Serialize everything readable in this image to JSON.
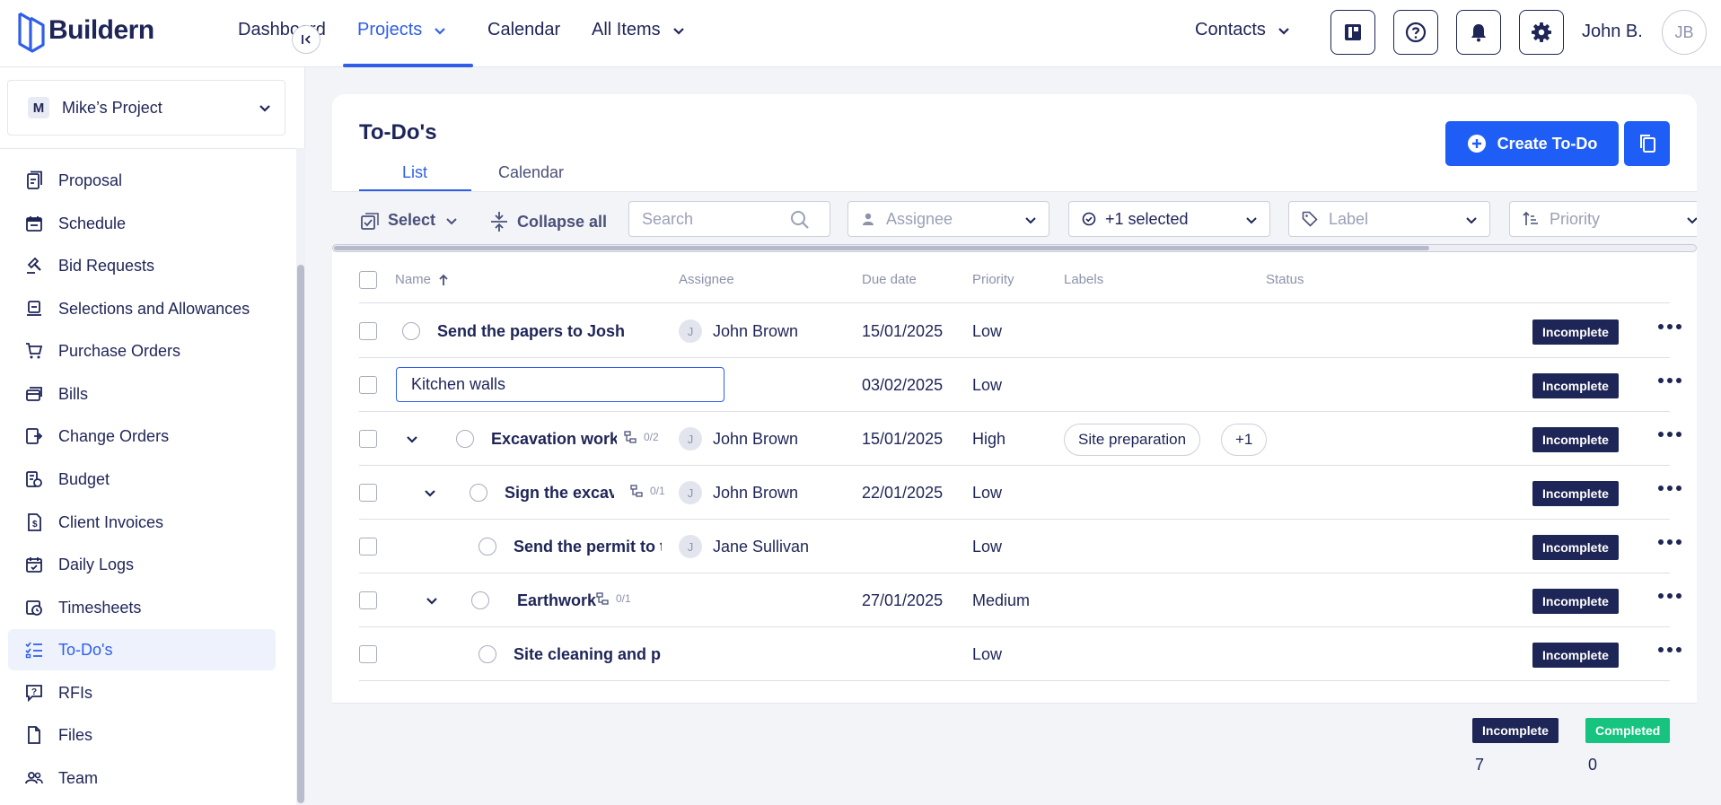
{
  "app": {
    "name": "Buildern"
  },
  "nav": {
    "dashboard": "Dashboard",
    "projects": "Projects",
    "calendar": "Calendar",
    "all_items": "All Items",
    "contacts": "Contacts"
  },
  "user": {
    "name": "John B.",
    "initials": "JB"
  },
  "sidebar": {
    "project_initial": "M",
    "project_name": "Mike’s Project",
    "items": [
      {
        "label": "Proposal",
        "icon": "proposal-icon"
      },
      {
        "label": "Schedule",
        "icon": "schedule-icon"
      },
      {
        "label": "Bid Requests",
        "icon": "bid-requests-icon"
      },
      {
        "label": "Selections and Allowances",
        "icon": "selections-icon"
      },
      {
        "label": "Purchase Orders",
        "icon": "cart-icon"
      },
      {
        "label": "Bills",
        "icon": "bills-icon"
      },
      {
        "label": "Change Orders",
        "icon": "change-orders-icon"
      },
      {
        "label": "Budget",
        "icon": "budget-icon"
      },
      {
        "label": "Client Invoices",
        "icon": "invoice-icon"
      },
      {
        "label": "Daily Logs",
        "icon": "daily-logs-icon"
      },
      {
        "label": "Timesheets",
        "icon": "timesheets-icon"
      },
      {
        "label": "To-Do's",
        "icon": "todo-icon",
        "active": true
      },
      {
        "label": "RFIs",
        "icon": "rfi-icon"
      },
      {
        "label": "Files",
        "icon": "files-icon"
      },
      {
        "label": "Team",
        "icon": "team-icon"
      }
    ]
  },
  "page": {
    "title": "To-Do's",
    "tabs": [
      "List",
      "Calendar"
    ],
    "create_label": "Create To-Do"
  },
  "toolbar": {
    "select_label": "Select",
    "collapse_label": "Collapse all",
    "search_placeholder": "Search",
    "assignee_placeholder": "Assignee",
    "status_filter_value": "+1 selected",
    "label_placeholder": "Label",
    "priority_placeholder": "Priority"
  },
  "table": {
    "columns": [
      "Name",
      "Assignee",
      "Due date",
      "Priority",
      "Labels",
      "Status"
    ],
    "rows": [
      {
        "name": "Send the papers to Josh",
        "assignee": "John Brown",
        "assignee_initial": "J",
        "due": "15/01/2025",
        "priority": "Low",
        "status": "Incomplete"
      },
      {
        "name": "Kitchen walls",
        "assignee": "",
        "due": "03/02/2025",
        "priority": "Low",
        "status": "Incomplete"
      },
      {
        "name": "Excavation work",
        "subtasks": "0/2",
        "assignee": "John Brown",
        "assignee_initial": "J",
        "due": "15/01/2025",
        "priority": "High",
        "labels": [
          "Site preparation",
          "+1"
        ],
        "status": "Incomplete"
      },
      {
        "name": "Sign the excavation permit",
        "subtasks": "0/1",
        "assignee": "John Brown",
        "assignee_initial": "J",
        "due": "22/01/2025",
        "priority": "Low",
        "status": "Incomplete"
      },
      {
        "name": "Send the permit to the agent",
        "assignee": "Jane Sullivan",
        "assignee_initial": "J",
        "due": "",
        "priority": "Low",
        "status": "Incomplete"
      },
      {
        "name": "Earthwork",
        "subtasks": "0/1",
        "assignee": "",
        "due": "27/01/2025",
        "priority": "Medium",
        "status": "Incomplete"
      },
      {
        "name": "Site cleaning and preparation",
        "assignee": "",
        "due": "",
        "priority": "Low",
        "status": "Incomplete"
      }
    ]
  },
  "summary": {
    "incomplete_label": "Incomplete",
    "incomplete_count": "7",
    "completed_label": "Completed",
    "completed_count": "0"
  },
  "colors": {
    "accent": "#2f5ee9",
    "navy": "#1e2557",
    "completed": "#16c47f"
  }
}
